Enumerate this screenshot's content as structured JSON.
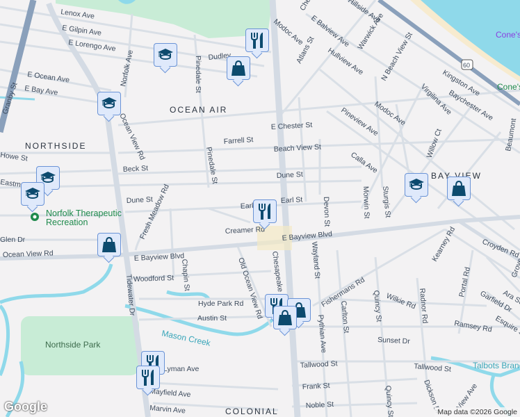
{
  "map": {
    "colors": {
      "land": "#f3f2f3",
      "road": "#d6dde6",
      "highway": "#8aa0bb",
      "water": "#8fd9ea",
      "park": "#c8ecd6",
      "sand": "#f7ebcf",
      "pin_fill": "#dfe9fb",
      "pin_icon": "#0c4a6e"
    },
    "neighborhoods": [
      "OCEAN AIR",
      "NORTHSIDE",
      "BAY VIEW",
      "COLONIAL"
    ],
    "streets": [
      "Lenox Ave",
      "E Gilpin Ave",
      "E Lorengo Ave",
      "E Ocean Ave",
      "E Bay Ave",
      "Granby St",
      "Norfolk Ave",
      "Dudley",
      "Pinedale St",
      "Ocean View Rd",
      "Farrell St",
      "Beck St",
      "Pinedale St",
      "Dune St",
      "Howe St",
      "Eastmont",
      "Fresh Meadow Rd",
      "Earl St",
      "Creamer Rd",
      "E Bayview Blvd",
      "Chapin St",
      "Woodford St",
      "Old Ocean View Rd",
      "Hyde Park Rd",
      "Austin St",
      "Tidewater Dr",
      "Chesapeake",
      "Modoc Ave",
      "Atlans St",
      "E Balview Ave",
      "Hullview Ave",
      "Warwick Ave",
      "Hillside Ave",
      "Chesapeake",
      "N Beach View St",
      "Kingston Ave",
      "Baychester Ave",
      "Virgilina Ave",
      "Modoc Ave",
      "E Chester St",
      "Pineview Ave",
      "Beach View St",
      "Calla Ave",
      "Willow Ct",
      "Beaumont",
      "Dune St",
      "Earl St",
      "Devon St",
      "Morwin St",
      "Sturgis St",
      "E Bayview Blvd",
      "Wayland St",
      "Kearney Rd",
      "Croyden Rd",
      "Fishermans Rd",
      "Portal Rd",
      "Wilkie Rd",
      "Radnor Rd",
      "Quincy St",
      "Carlton St",
      "Pythian Ave",
      "Garfield Dr",
      "Ara St",
      "Esquire St",
      "Ramsey Rd",
      "Sunset Dr",
      "Tallwood St",
      "Tallwood St",
      "Frank St",
      "Noble St",
      "Quincy St",
      "Dickson Dr",
      "View Ave",
      "Mayfield Ave",
      "Marvin Ave",
      "Lyman Ave",
      "Glen Dr",
      "Ocean View Rd",
      "Grove"
    ],
    "highway_shield": "60",
    "water_features": [
      "Mason Creek",
      "Talbots Branch"
    ],
    "parks": [
      "Northside Park"
    ],
    "beach_labels": [
      "Cone's",
      "Cone's"
    ],
    "poi": {
      "name_line1": "Norfolk Therapeutic",
      "name_line2": "Recreation"
    },
    "markers": [
      "school",
      "restaurant",
      "shopping",
      "school",
      "school",
      "school",
      "restaurant",
      "school",
      "shopping",
      "shopping",
      "restaurant",
      "shopping",
      "shopping",
      "restaurant",
      "restaurant"
    ],
    "logo": "Google",
    "attribution": "Map data ©2026 Google"
  }
}
